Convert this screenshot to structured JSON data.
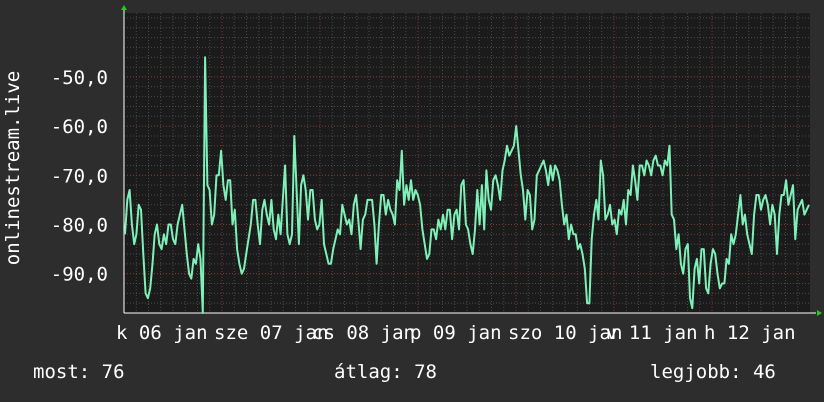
{
  "chart_data": {
    "type": "line",
    "ylabel": "onlinestream.live",
    "ylim": [
      -98,
      -37
    ],
    "yticks": [
      -50,
      -60,
      -70,
      -80,
      -90
    ],
    "ytick_labels": [
      "-50,0",
      "-60,0",
      "-70,0",
      "-80,0",
      "-90,0"
    ],
    "xtick_labels": [
      "k 06 jan",
      "sze 07 jan",
      "cs 08 jan",
      "p 09 jan",
      "szo 10 jan",
      "v 11 jan",
      "h 12 jan"
    ],
    "series": [
      {
        "color": "#7ef0b8",
        "values": [
          -82,
          -75,
          -73,
          -80,
          -84,
          -82,
          -76,
          -77,
          -86,
          -94,
          -95,
          -93,
          -88,
          -82,
          -80,
          -84,
          -85,
          -82,
          -84,
          -80,
          -80,
          -83,
          -84,
          -80,
          -78,
          -76,
          -81,
          -86,
          -90,
          -91,
          -87,
          -88,
          -84,
          -87,
          -98,
          -46,
          -72,
          -73,
          -80,
          -78,
          -70,
          -70,
          -65,
          -72,
          -75,
          -71,
          -71,
          -80,
          -77,
          -85,
          -88,
          -90,
          -89,
          -86,
          -83,
          -80,
          -75,
          -75,
          -80,
          -84,
          -77,
          -75,
          -78,
          -80,
          -75,
          -81,
          -83,
          -78,
          -82,
          -75,
          -68,
          -82,
          -84,
          -82,
          -62,
          -73,
          -84,
          -72,
          -70,
          -73,
          -79,
          -73,
          -73,
          -79,
          -81,
          -80,
          -75,
          -84,
          -86,
          -88,
          -88,
          -85,
          -83,
          -81,
          -82,
          -76,
          -78,
          -80,
          -79,
          -82,
          -76,
          -74,
          -79,
          -85,
          -79,
          -78,
          -75,
          -75,
          -75,
          -80,
          -88,
          -80,
          -74,
          -74,
          -78,
          -75,
          -77,
          -78,
          -80,
          -71,
          -73,
          -65,
          -76,
          -72,
          -75,
          -71,
          -75,
          -73,
          -74,
          -76,
          -81,
          -84,
          -87,
          -86,
          -81,
          -81,
          -83,
          -79,
          -81,
          -78,
          -81,
          -77,
          -77,
          -83,
          -78,
          -77,
          -81,
          -72,
          -71,
          -80,
          -81,
          -84,
          -86,
          -81,
          -73,
          -80,
          -72,
          -81,
          -69,
          -75,
          -77,
          -71,
          -70,
          -72,
          -75,
          -69,
          -67,
          -64,
          -66,
          -65,
          -64,
          -60,
          -65,
          -70,
          -73,
          -79,
          -73,
          -74,
          -81,
          -79,
          -70,
          -69,
          -68,
          -67,
          -69,
          -72,
          -68,
          -71,
          -68,
          -69,
          -71,
          -76,
          -80,
          -78,
          -83,
          -80,
          -82,
          -82,
          -85,
          -84,
          -86,
          -89,
          -96,
          -96,
          -83,
          -78,
          -75,
          -79,
          -67,
          -70,
          -79,
          -78,
          -76,
          -80,
          -79,
          -82,
          -77,
          -78,
          -75,
          -80,
          -73,
          -74,
          -68,
          -71,
          -75,
          -68,
          -68,
          -70,
          -67,
          -68,
          -70,
          -67,
          -66,
          -68,
          -68,
          -70,
          -67,
          -68,
          -64,
          -78,
          -79,
          -85,
          -82,
          -88,
          -90,
          -85,
          -84,
          -95,
          -97,
          -89,
          -87,
          -92,
          -85,
          -85,
          -93,
          -94,
          -88,
          -85,
          -86,
          -90,
          -93,
          -92,
          -92,
          -87,
          -88,
          -82,
          -84,
          -82,
          -78,
          -74,
          -80,
          -78,
          -82,
          -84,
          -86,
          -78,
          -74,
          -74,
          -77,
          -75,
          -74,
          -76,
          -80,
          -76,
          -78,
          -86,
          -78,
          -74,
          -74,
          -71,
          -76,
          -74,
          -72,
          -83,
          -77,
          -76,
          -75,
          -78,
          -77,
          -76
        ]
      }
    ],
    "grid": true
  },
  "stats": {
    "now": "most: 76",
    "avg": "átlag: 78",
    "best": "legjobb: 46"
  }
}
